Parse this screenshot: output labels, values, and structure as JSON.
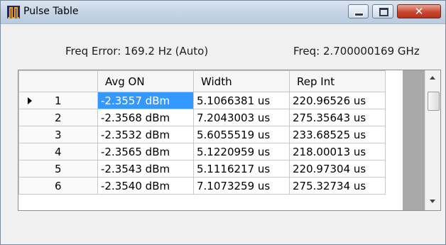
{
  "window": {
    "title": "Pulse Table",
    "icon": "waveform-app-icon",
    "controls": {
      "minimize": "minimize",
      "maximize": "maximize",
      "close": "✕"
    }
  },
  "status": {
    "freq_error": "Freq Error: 169.2 Hz (Auto)",
    "freq": "Freq: 2.700000169 GHz"
  },
  "table": {
    "columns": [
      "Avg ON",
      "Width",
      "Rep Int"
    ],
    "rows": [
      {
        "index": "1",
        "avg_on": "-2.3557 dBm",
        "width": "5.1066381 us",
        "rep_int": "220.96526 us",
        "current": true
      },
      {
        "index": "2",
        "avg_on": "-2.3568 dBm",
        "width": "7.2043003 us",
        "rep_int": "275.35643 us"
      },
      {
        "index": "3",
        "avg_on": "-2.3532 dBm",
        "width": "5.6055519 us",
        "rep_int": "233.68525 us"
      },
      {
        "index": "4",
        "avg_on": "-2.3565 dBm",
        "width": "5.1220959 us",
        "rep_int": "218.00013 us"
      },
      {
        "index": "5",
        "avg_on": "-2.3543 dBm",
        "width": "5.1116217 us",
        "rep_int": "220.97304 us"
      },
      {
        "index": "6",
        "avg_on": "-2.3540 dBm",
        "width": "7.1073259 us",
        "rep_int": "275.32734 us"
      }
    ],
    "selected_cell": "-2.3557 dBm"
  },
  "colors": {
    "selection": "#3399ff",
    "close_button": "#c8462f"
  }
}
